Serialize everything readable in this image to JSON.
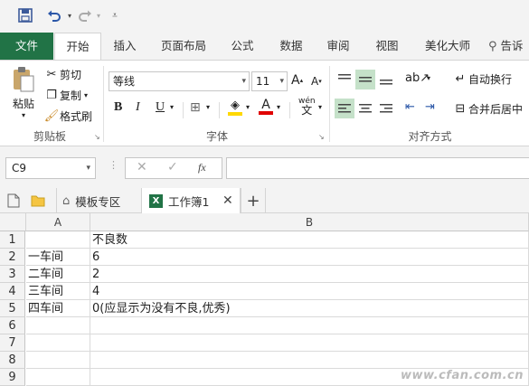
{
  "qat": {
    "save_icon": "save-icon",
    "undo_icon": "undo-icon",
    "redo_icon": "redo-icon",
    "customize_icon": "customize-icon"
  },
  "tabs": {
    "file": "文件",
    "home": "开始",
    "insert": "插入",
    "page_layout": "页面布局",
    "formulas": "公式",
    "data": "数据",
    "review": "审阅",
    "view": "视图",
    "beautify": "美化大师",
    "tell_me": "告诉"
  },
  "ribbon": {
    "clipboard": {
      "paste": "粘贴",
      "cut": "剪切",
      "copy": "复制",
      "format_painter": "格式刷",
      "group_label": "剪贴板"
    },
    "font": {
      "font_name": "等线",
      "font_size": "11",
      "bold": "B",
      "italic": "I",
      "underline": "U",
      "phonetic": "wén",
      "group_label": "字体"
    },
    "alignment": {
      "wrap_text": "自动换行",
      "merge_center": "合并后居中",
      "group_label": "对齐方式"
    }
  },
  "formula_bar": {
    "name_box": "C9",
    "fx": "fx",
    "content": ""
  },
  "sheet_tabs": {
    "template_zone": "模板专区",
    "workbook": "工作簿1"
  },
  "sheet": {
    "col_headers": [
      "A",
      "B"
    ],
    "rows": [
      {
        "num": "1",
        "a": "",
        "b": "不良数"
      },
      {
        "num": "2",
        "a": "一车间",
        "b": "6"
      },
      {
        "num": "3",
        "a": "二车间",
        "b": "2"
      },
      {
        "num": "4",
        "a": "三车间",
        "b": "4"
      },
      {
        "num": "5",
        "a": "四车间",
        "b": "0(应显示为没有不良,优秀)"
      },
      {
        "num": "6",
        "a": "",
        "b": ""
      },
      {
        "num": "7",
        "a": "",
        "b": ""
      },
      {
        "num": "8",
        "a": "",
        "b": ""
      },
      {
        "num": "9",
        "a": "",
        "b": ""
      }
    ]
  },
  "watermark": "www.cfan.com.cn",
  "colors": {
    "excel_green": "#217346",
    "highlight": "#c5e1c9",
    "fill_yellow": "#ffd800",
    "font_red": "#e00000"
  }
}
